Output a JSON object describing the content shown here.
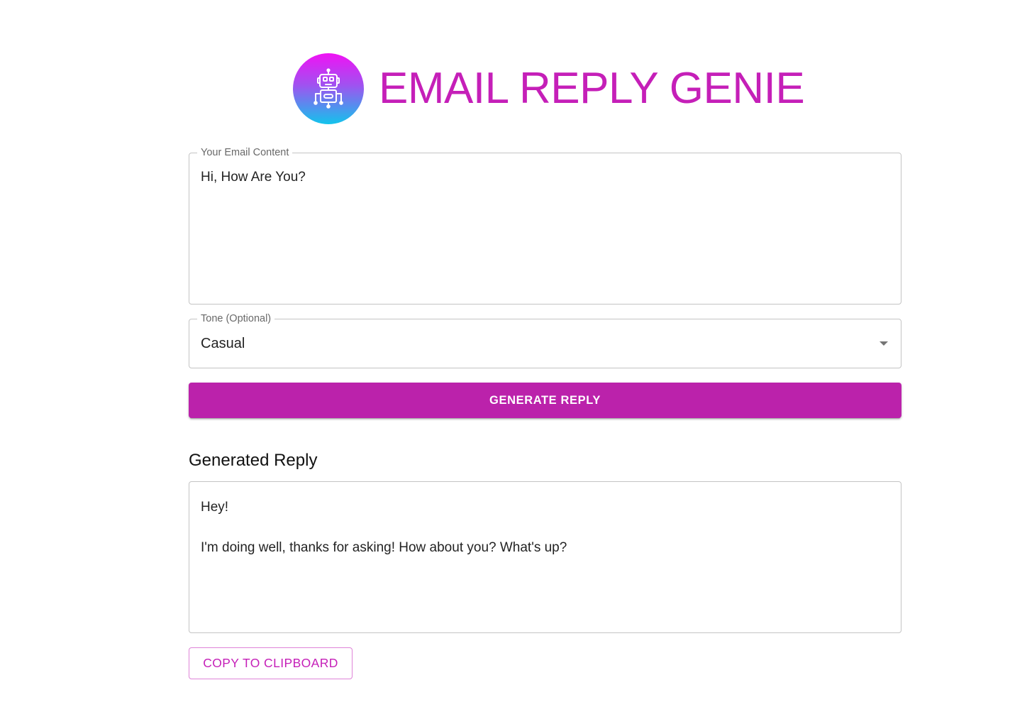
{
  "header": {
    "title": "EMAIL REPLY GENIE",
    "logo_icon": "robot-icon"
  },
  "form": {
    "email_content": {
      "label": "Your Email Content",
      "value": "Hi, How Are You?"
    },
    "tone": {
      "label": "Tone (Optional)",
      "selected": "Casual"
    },
    "generate_button": "GENERATE REPLY"
  },
  "result": {
    "heading": "Generated Reply",
    "text": "Hey!\n\nI'm doing well, thanks for asking! How about you? What's up?",
    "copy_button": "COPY TO CLIPBOARD"
  },
  "colors": {
    "accent": "#c51fb8",
    "button_bg": "#bb22ab",
    "border": "#c4c4c4"
  }
}
